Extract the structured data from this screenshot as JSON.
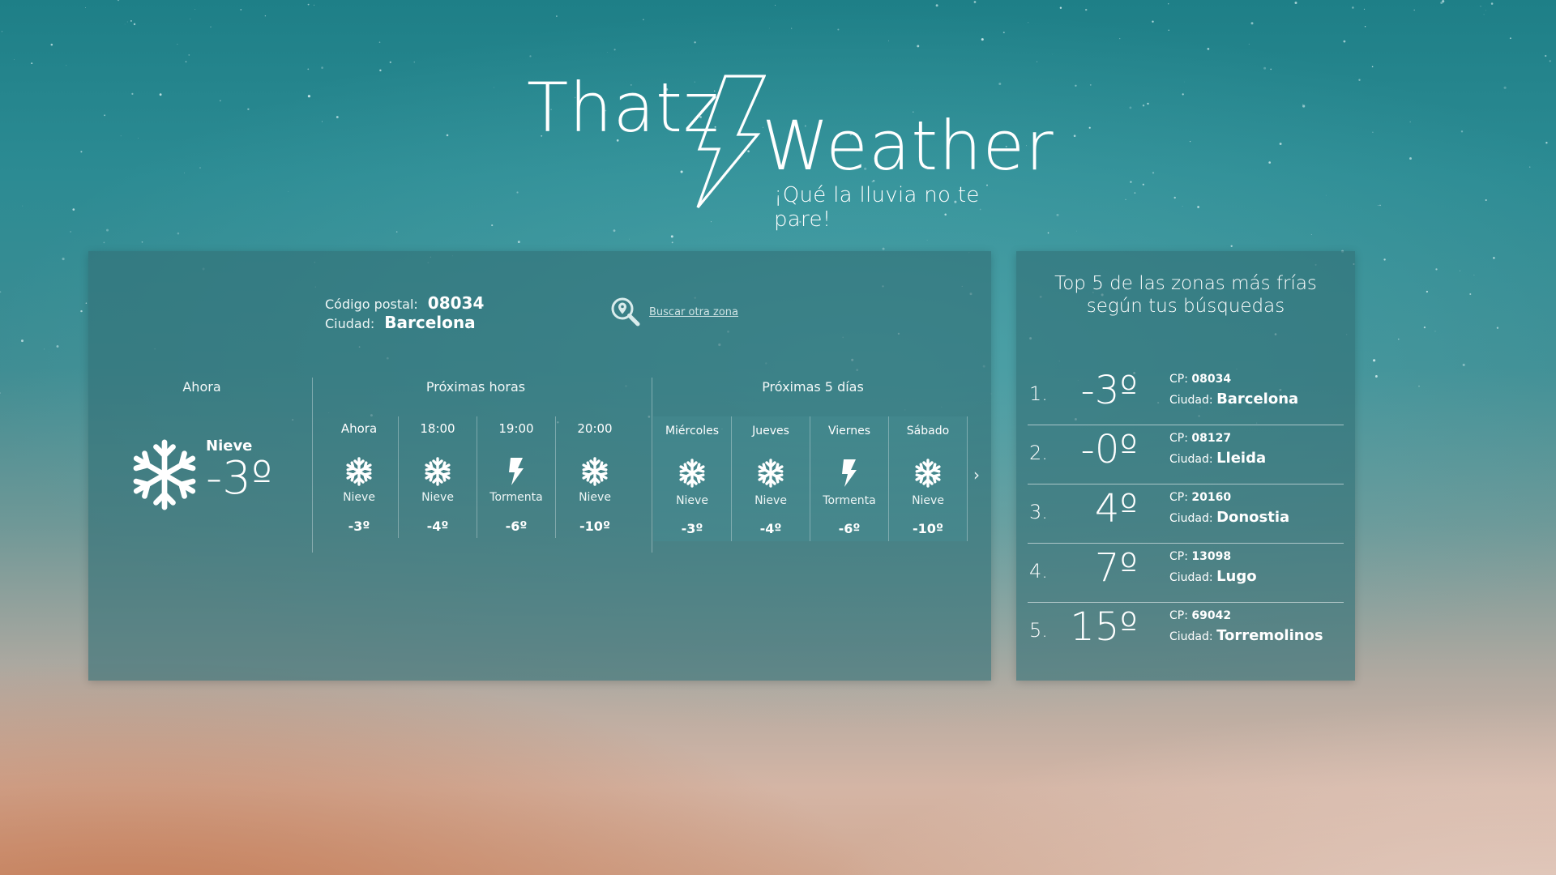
{
  "header": {
    "logo_part1": "Thatz",
    "logo_part2": "Weather",
    "tagline": "¡Qué la lluvia no te pare!"
  },
  "location": {
    "postal_label": "Código postal:",
    "postal_code": "08034",
    "city_label": "Ciudad:",
    "city": "Barcelona",
    "search_link": "Buscar otra zona",
    "search_icon": "location-search-icon"
  },
  "now": {
    "title": "Ahora",
    "description": "Nieve",
    "temperature": "-3º",
    "icon": "snowflake-icon"
  },
  "hourly": {
    "title": "Próximas horas",
    "items": [
      {
        "time": "Ahora",
        "icon": "snowflake-icon",
        "description": "Nieve",
        "temp": "-3º"
      },
      {
        "time": "18:00",
        "icon": "snowflake-icon",
        "description": "Nieve",
        "temp": "-4º"
      },
      {
        "time": "19:00",
        "icon": "lightning-icon",
        "description": "Tormenta",
        "temp": "-6º"
      },
      {
        "time": "20:00",
        "icon": "snowflake-icon",
        "description": "Nieve",
        "temp": "-10º"
      }
    ]
  },
  "daily": {
    "title": "Próximas 5 días",
    "next_icon": "chevron-right-icon",
    "items": [
      {
        "day": "Miércoles",
        "icon": "snowflake-icon",
        "description": "Nieve",
        "temp": "-3º"
      },
      {
        "day": "Jueves",
        "icon": "snowflake-icon",
        "description": "Nieve",
        "temp": "-4º"
      },
      {
        "day": "Viernes",
        "icon": "lightning-icon",
        "description": "Tormenta",
        "temp": "-6º"
      },
      {
        "day": "Sábado",
        "icon": "snowflake-icon",
        "description": "Nieve",
        "temp": "-10º"
      }
    ]
  },
  "top5": {
    "title_line1": "Top 5 de las zonas más frías",
    "title_line2": "según tus búsquedas",
    "cp_label": "CP:",
    "city_label": "Ciudad:",
    "items": [
      {
        "rank": "1.",
        "temp": "-3º",
        "cp": "08034",
        "city": "Barcelona"
      },
      {
        "rank": "2.",
        "temp": "-0º",
        "cp": "08127",
        "city": "Lleida"
      },
      {
        "rank": "3.",
        "temp": "4º",
        "cp": "20160",
        "city": "Donostia"
      },
      {
        "rank": "4.",
        "temp": "7º",
        "cp": "13098",
        "city": "Lugo"
      },
      {
        "rank": "5.",
        "temp": "15º",
        "cp": "69042",
        "city": "Torremolinos"
      }
    ]
  },
  "colors": {
    "panel": "#327076",
    "text": "#ffffff",
    "sky_top": "#1e7f87",
    "sky_bottom": "#d1a993"
  }
}
